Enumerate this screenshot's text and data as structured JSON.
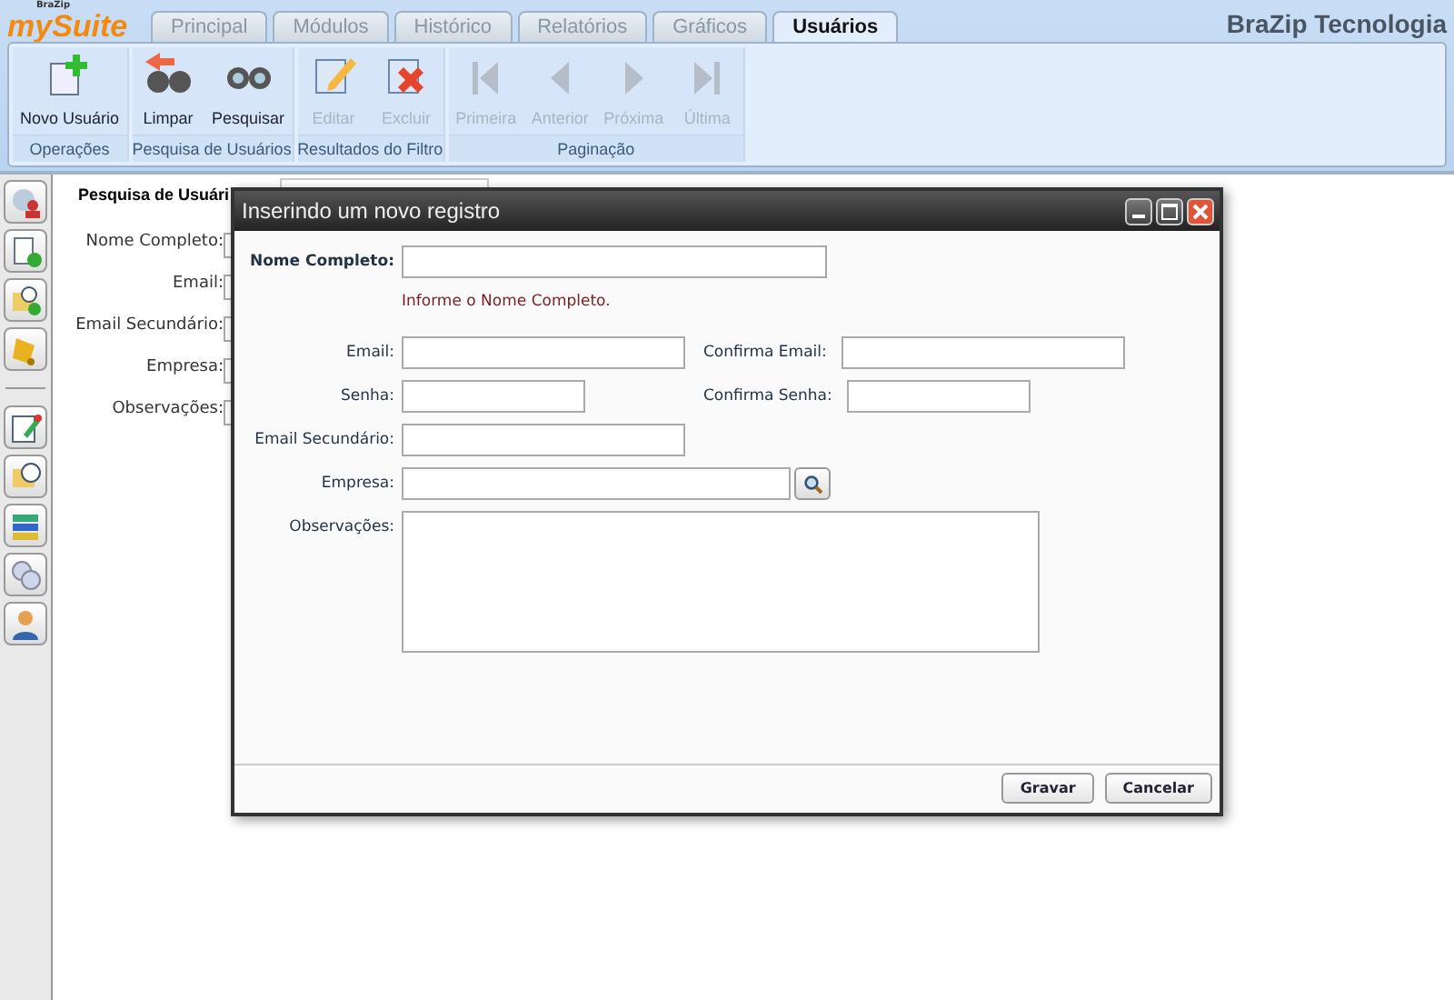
{
  "brand": {
    "small": "BraZip",
    "name": "mySuite"
  },
  "tabs": [
    {
      "label": "Principal",
      "selected": false
    },
    {
      "label": "Módulos",
      "selected": false
    },
    {
      "label": "Histórico",
      "selected": false
    },
    {
      "label": "Relatórios",
      "selected": false
    },
    {
      "label": "Gráficos",
      "selected": false
    },
    {
      "label": "Usuários",
      "selected": true
    }
  ],
  "company": "BraZip Tecnologia",
  "ribbon": [
    {
      "title": "Operações",
      "buttons": [
        {
          "label": "Novo Usuário",
          "kind": "new",
          "disabled": false
        }
      ]
    },
    {
      "title": "Pesquisa de Usuários",
      "buttons": [
        {
          "label": "Limpar",
          "kind": "clear",
          "disabled": false
        },
        {
          "label": "Pesquisar",
          "kind": "search",
          "disabled": false
        }
      ]
    },
    {
      "title": "Resultados do Filtro",
      "buttons": [
        {
          "label": "Editar",
          "kind": "edit",
          "disabled": true
        },
        {
          "label": "Excluir",
          "kind": "delete",
          "disabled": true
        }
      ]
    },
    {
      "title": "Paginação",
      "buttons": [
        {
          "label": "Primeira",
          "kind": "first",
          "disabled": true
        },
        {
          "label": "Anterior",
          "kind": "prev",
          "disabled": true
        },
        {
          "label": "Próxima",
          "kind": "next",
          "disabled": true
        },
        {
          "label": "Última",
          "kind": "last",
          "disabled": true
        }
      ]
    }
  ],
  "background_panel": {
    "tab": "Pesquisa de Usuári",
    "labels": [
      "Nome Completo:",
      "Email:",
      "Email Secundário:",
      "Empresa:",
      "Observações:"
    ]
  },
  "dialog": {
    "title": "Inserindo um novo registro",
    "name_label": "Nome Completo:",
    "name_hint": "Informe o Nome Completo.",
    "email_label": "Email:",
    "confirm_email_label": "Confirma Email:",
    "password_label": "Senha:",
    "confirm_password_label": "Confirma Senha:",
    "secondary_email_label": "Email Secundário:",
    "company_label": "Empresa:",
    "notes_label": "Observações:",
    "buttons": [
      "Gravar",
      "Cancelar"
    ]
  }
}
